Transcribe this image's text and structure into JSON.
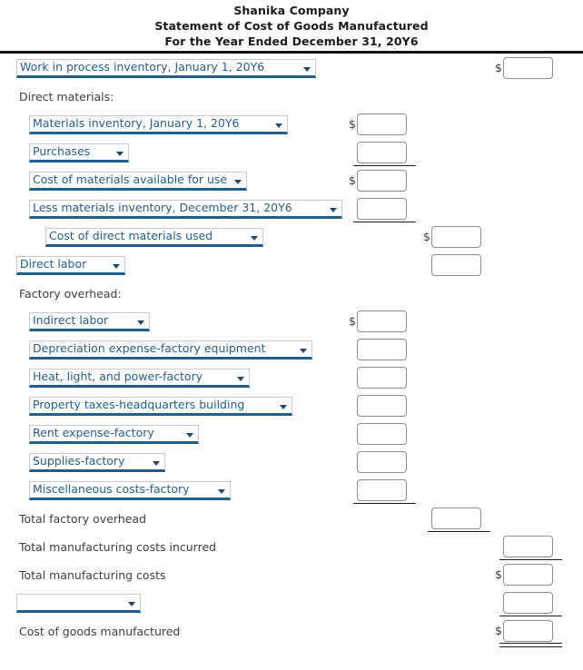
{
  "header": {
    "company": "Shanika Company",
    "statement": "Statement of Cost of Goods Manufactured",
    "period": "For the Year Ended December 31, 20Y6"
  },
  "currency_symbol": "$",
  "colors": {
    "select_text": "#1f5f8f",
    "select_underline": "#1f5f8f",
    "label_text": "#3a3f44",
    "rule": "#1b1b1b"
  },
  "rows": [
    {
      "id": "work-in-process-beginning",
      "kind": "select",
      "label": "Work in process inventory, January 1, 20Y6",
      "indent": 18,
      "select_width": 330,
      "amount": {
        "column": 3,
        "value": "",
        "dollar": "$"
      }
    },
    {
      "id": "direct-materials-heading",
      "kind": "label",
      "label": "Direct materials:",
      "indent": 21
    },
    {
      "id": "materials-inventory-beginning",
      "kind": "select",
      "label": "Materials inventory, January 1, 20Y6",
      "indent": 32,
      "select_width": 285,
      "amount": {
        "column": 1,
        "value": "",
        "dollar": "$"
      }
    },
    {
      "id": "purchases",
      "kind": "select",
      "label": "Purchases",
      "indent": 32,
      "select_width": 110,
      "amount": {
        "column": 1,
        "value": "",
        "dollar": ""
      },
      "rule_below": 1
    },
    {
      "id": "cost-of-materials-available",
      "kind": "select",
      "label": "Cost of materials available for use",
      "indent": 32,
      "select_width": 240,
      "amount": {
        "column": 1,
        "value": "",
        "dollar": "$"
      }
    },
    {
      "id": "less-materials-inventory-ending",
      "kind": "select",
      "label": "Less materials inventory, December 31, 20Y6",
      "indent": 32,
      "select_width": 345,
      "amount": {
        "column": 1,
        "value": "",
        "dollar": ""
      },
      "rule_below": 1
    },
    {
      "id": "cost-of-direct-materials-used",
      "kind": "select",
      "label": "Cost of direct materials used",
      "indent": 50,
      "select_width": 240,
      "amount": {
        "column": 2,
        "value": "",
        "dollar": "$"
      }
    },
    {
      "id": "direct-labor",
      "kind": "select",
      "label": "Direct labor",
      "indent": 18,
      "select_width": 120,
      "amount": {
        "column": 2,
        "value": "",
        "dollar": ""
      }
    },
    {
      "id": "factory-overhead-heading",
      "kind": "label",
      "label": "Factory overhead:",
      "indent": 21
    },
    {
      "id": "indirect-labor",
      "kind": "select",
      "label": "Indirect labor",
      "indent": 32,
      "select_width": 133,
      "amount": {
        "column": 1,
        "value": "",
        "dollar": "$"
      }
    },
    {
      "id": "depreciation-expense-factory-equipment",
      "kind": "select",
      "label": "Depreciation expense-factory equipment",
      "indent": 32,
      "select_width": 312,
      "amount": {
        "column": 1,
        "value": "",
        "dollar": ""
      }
    },
    {
      "id": "heat-light-and-power-factory",
      "kind": "select",
      "label": "Heat, light, and power-factory",
      "indent": 32,
      "select_width": 243,
      "amount": {
        "column": 1,
        "value": "",
        "dollar": ""
      }
    },
    {
      "id": "property-taxes-headquarters-building",
      "kind": "select",
      "label": "Property taxes-headquarters building",
      "indent": 32,
      "select_width": 290,
      "amount": {
        "column": 1,
        "value": "",
        "dollar": ""
      }
    },
    {
      "id": "rent-expense-factory",
      "kind": "select",
      "label": "Rent expense-factory",
      "indent": 32,
      "select_width": 187,
      "amount": {
        "column": 1,
        "value": "",
        "dollar": ""
      }
    },
    {
      "id": "supplies-factory",
      "kind": "select",
      "label": "Supplies-factory",
      "indent": 32,
      "select_width": 150,
      "amount": {
        "column": 1,
        "value": "",
        "dollar": ""
      }
    },
    {
      "id": "miscellaneous-costs-factory",
      "kind": "select",
      "label": "Miscellaneous costs-factory",
      "indent": 32,
      "select_width": 222,
      "amount": {
        "column": 1,
        "value": "",
        "dollar": ""
      },
      "rule_below": 1
    },
    {
      "id": "total-factory-overhead",
      "kind": "label",
      "label": "Total factory overhead",
      "indent": 21,
      "amount": {
        "column": 2,
        "value": "",
        "dollar": ""
      },
      "rule_below": 2
    },
    {
      "id": "total-manufacturing-costs-incurred",
      "kind": "label",
      "label": "Total manufacturing costs incurred",
      "indent": 21,
      "amount": {
        "column": 3,
        "value": "",
        "dollar": ""
      },
      "rule_below": 3
    },
    {
      "id": "total-manufacturing-costs",
      "kind": "label",
      "label": "Total manufacturing costs",
      "indent": 21,
      "amount": {
        "column": 3,
        "value": "",
        "dollar": "$"
      }
    },
    {
      "id": "deduction-line",
      "kind": "select",
      "label": "",
      "indent": 18,
      "select_width": 137,
      "amount": {
        "column": 3,
        "value": "",
        "dollar": ""
      },
      "rule_below": 3
    },
    {
      "id": "cost-of-goods-manufactured",
      "kind": "label",
      "label": "Cost of goods manufactured",
      "indent": 21,
      "amount": {
        "column": 3,
        "value": "",
        "dollar": "$"
      },
      "rule_below_double": 3
    }
  ]
}
